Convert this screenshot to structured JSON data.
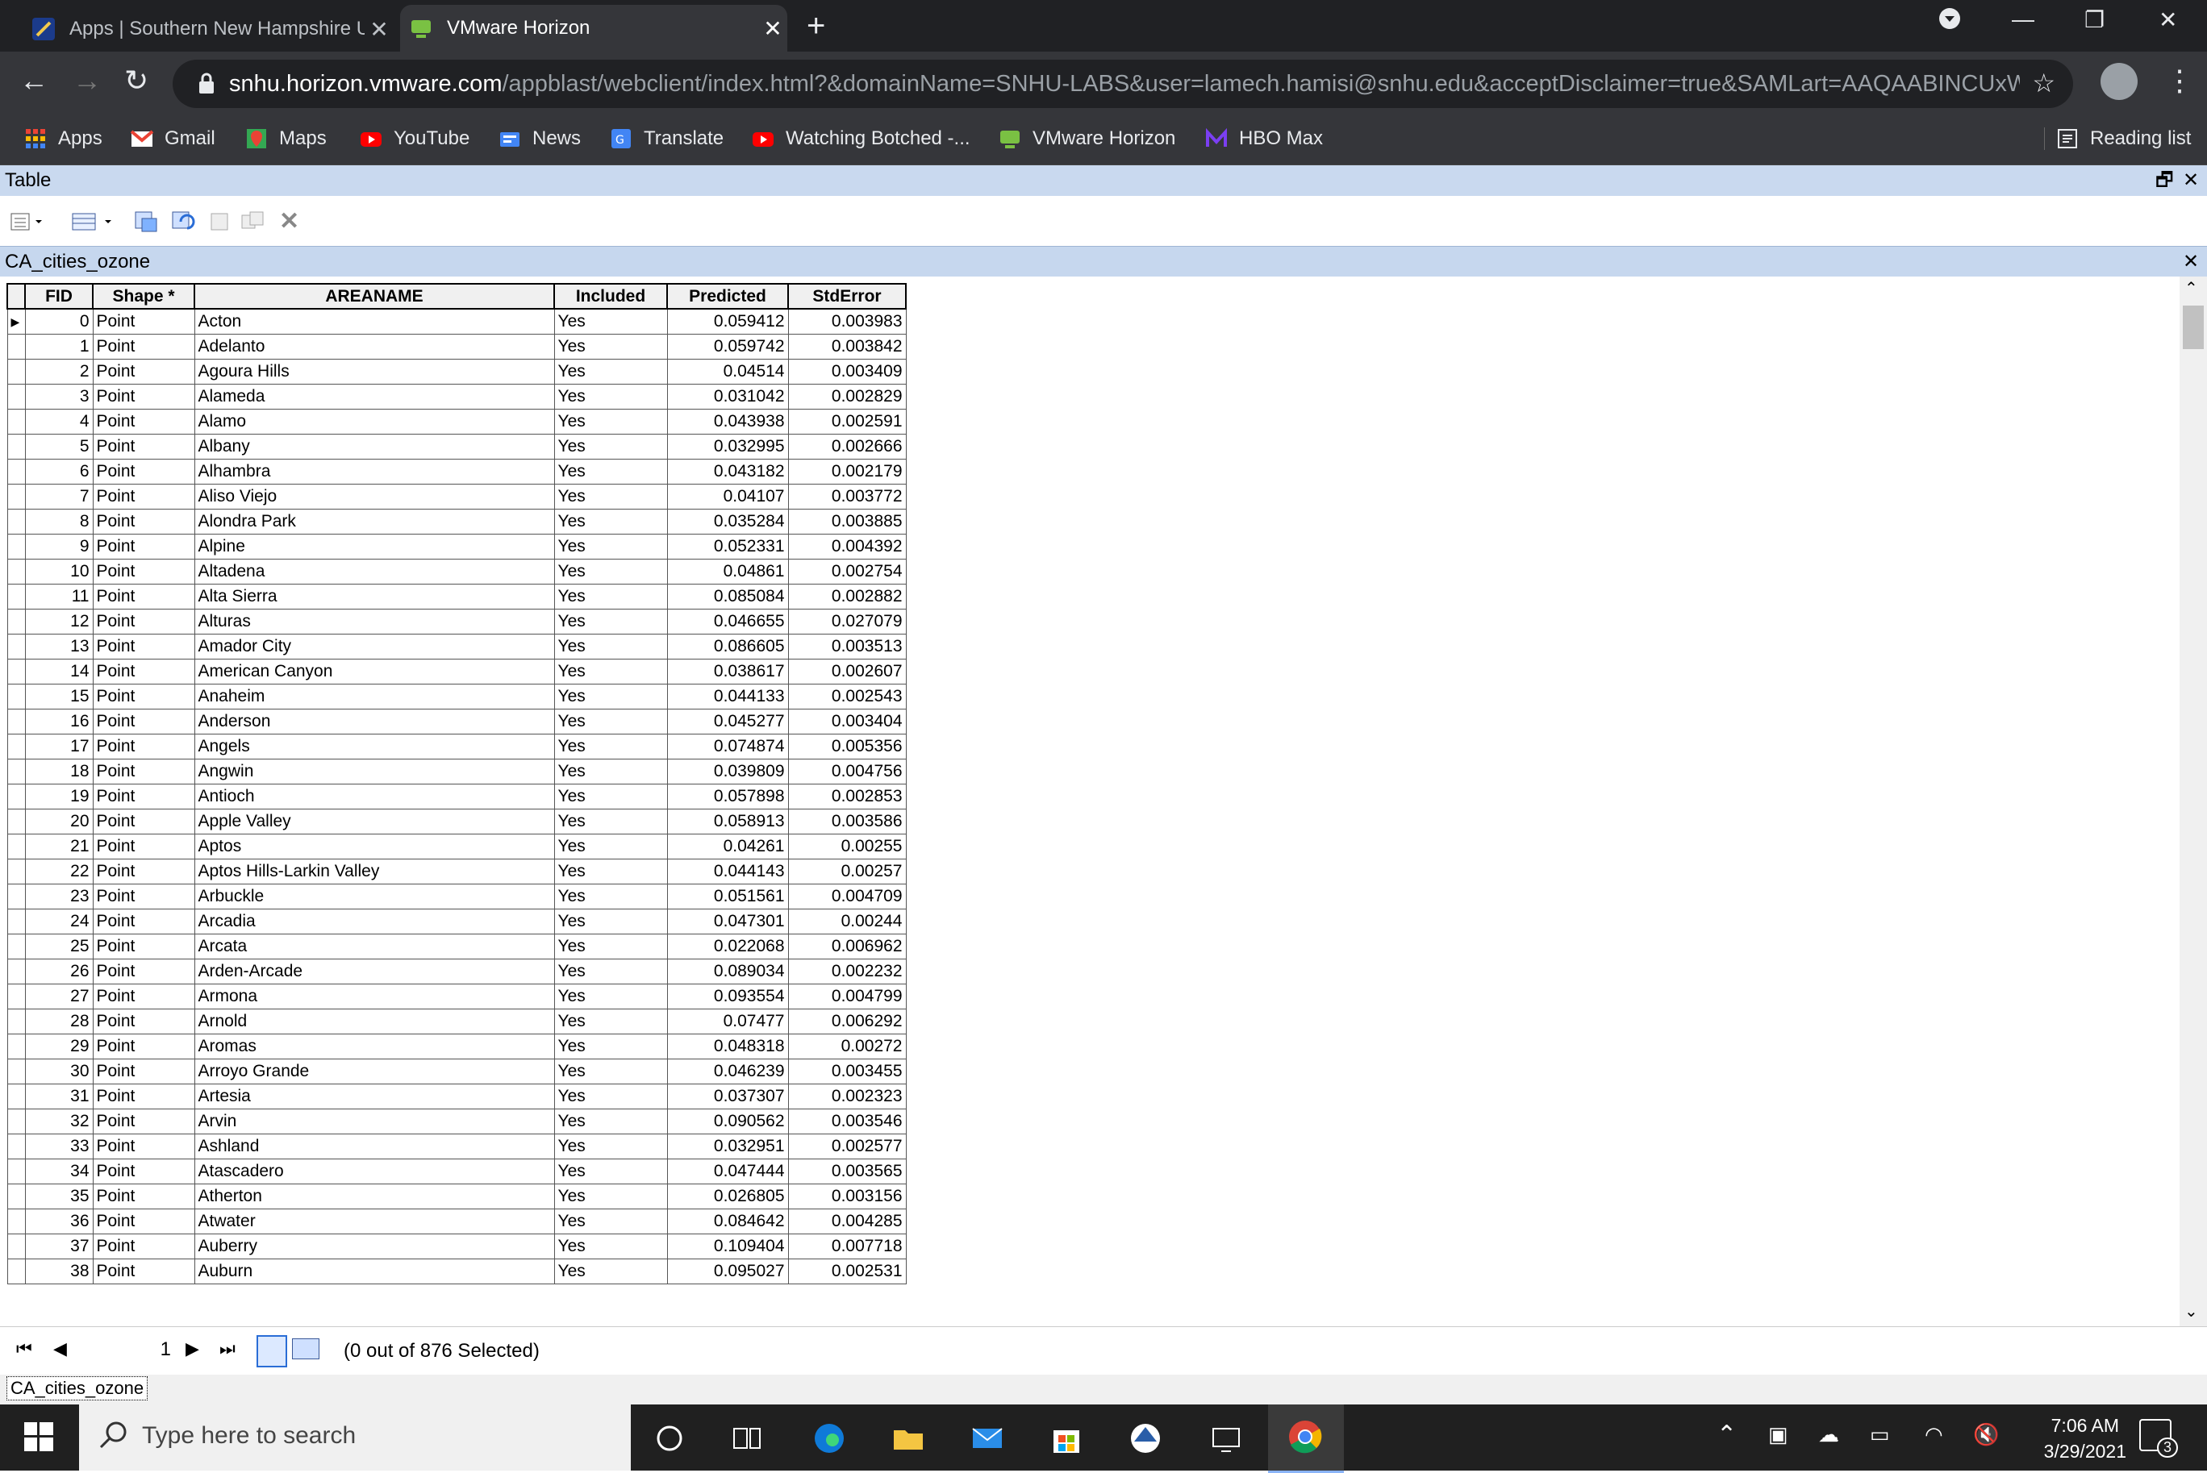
{
  "browser": {
    "tabs": [
      {
        "title": "Apps | Southern New Hampshire University",
        "active": false
      },
      {
        "title": "VMware Horizon",
        "active": true
      }
    ],
    "url_host": "snhu.horizon.vmware.com",
    "url_path": "/appblast/webclient/index.html?&domainName=SNHU-LABS&user=lamech.hamisi@snhu.edu&acceptDisclaimer=true&SAMLart=AAQAABINCUxWrog...",
    "bookmarks": [
      "Apps",
      "Gmail",
      "Maps",
      "YouTube",
      "News",
      "Translate",
      "Watching Botched -...",
      "VMware Horizon",
      "HBO Max"
    ],
    "reading_list": "Reading list"
  },
  "table_window": {
    "title": "Table",
    "layer_name": "CA_cities_ozone",
    "columns": [
      "FID",
      "Shape *",
      "AREANAME",
      "Included",
      "Predicted",
      "StdError"
    ],
    "rows": [
      [
        "0",
        "Point",
        "Acton",
        "Yes",
        "0.059412",
        "0.003983"
      ],
      [
        "1",
        "Point",
        "Adelanto",
        "Yes",
        "0.059742",
        "0.003842"
      ],
      [
        "2",
        "Point",
        "Agoura Hills",
        "Yes",
        "0.04514",
        "0.003409"
      ],
      [
        "3",
        "Point",
        "Alameda",
        "Yes",
        "0.031042",
        "0.002829"
      ],
      [
        "4",
        "Point",
        "Alamo",
        "Yes",
        "0.043938",
        "0.002591"
      ],
      [
        "5",
        "Point",
        "Albany",
        "Yes",
        "0.032995",
        "0.002666"
      ],
      [
        "6",
        "Point",
        "Alhambra",
        "Yes",
        "0.043182",
        "0.002179"
      ],
      [
        "7",
        "Point",
        "Aliso Viejo",
        "Yes",
        "0.04107",
        "0.003772"
      ],
      [
        "8",
        "Point",
        "Alondra Park",
        "Yes",
        "0.035284",
        "0.003885"
      ],
      [
        "9",
        "Point",
        "Alpine",
        "Yes",
        "0.052331",
        "0.004392"
      ],
      [
        "10",
        "Point",
        "Altadena",
        "Yes",
        "0.04861",
        "0.002754"
      ],
      [
        "11",
        "Point",
        "Alta Sierra",
        "Yes",
        "0.085084",
        "0.002882"
      ],
      [
        "12",
        "Point",
        "Alturas",
        "Yes",
        "0.046655",
        "0.027079"
      ],
      [
        "13",
        "Point",
        "Amador City",
        "Yes",
        "0.086605",
        "0.003513"
      ],
      [
        "14",
        "Point",
        "American Canyon",
        "Yes",
        "0.038617",
        "0.002607"
      ],
      [
        "15",
        "Point",
        "Anaheim",
        "Yes",
        "0.044133",
        "0.002543"
      ],
      [
        "16",
        "Point",
        "Anderson",
        "Yes",
        "0.045277",
        "0.003404"
      ],
      [
        "17",
        "Point",
        "Angels",
        "Yes",
        "0.074874",
        "0.005356"
      ],
      [
        "18",
        "Point",
        "Angwin",
        "Yes",
        "0.039809",
        "0.004756"
      ],
      [
        "19",
        "Point",
        "Antioch",
        "Yes",
        "0.057898",
        "0.002853"
      ],
      [
        "20",
        "Point",
        "Apple Valley",
        "Yes",
        "0.058913",
        "0.003586"
      ],
      [
        "21",
        "Point",
        "Aptos",
        "Yes",
        "0.04261",
        "0.00255"
      ],
      [
        "22",
        "Point",
        "Aptos Hills-Larkin Valley",
        "Yes",
        "0.044143",
        "0.00257"
      ],
      [
        "23",
        "Point",
        "Arbuckle",
        "Yes",
        "0.051561",
        "0.004709"
      ],
      [
        "24",
        "Point",
        "Arcadia",
        "Yes",
        "0.047301",
        "0.00244"
      ],
      [
        "25",
        "Point",
        "Arcata",
        "Yes",
        "0.022068",
        "0.006962"
      ],
      [
        "26",
        "Point",
        "Arden-Arcade",
        "Yes",
        "0.089034",
        "0.002232"
      ],
      [
        "27",
        "Point",
        "Armona",
        "Yes",
        "0.093554",
        "0.004799"
      ],
      [
        "28",
        "Point",
        "Arnold",
        "Yes",
        "0.07477",
        "0.006292"
      ],
      [
        "29",
        "Point",
        "Aromas",
        "Yes",
        "0.048318",
        "0.00272"
      ],
      [
        "30",
        "Point",
        "Arroyo Grande",
        "Yes",
        "0.046239",
        "0.003455"
      ],
      [
        "31",
        "Point",
        "Artesia",
        "Yes",
        "0.037307",
        "0.002323"
      ],
      [
        "32",
        "Point",
        "Arvin",
        "Yes",
        "0.090562",
        "0.003546"
      ],
      [
        "33",
        "Point",
        "Ashland",
        "Yes",
        "0.032951",
        "0.002577"
      ],
      [
        "34",
        "Point",
        "Atascadero",
        "Yes",
        "0.047444",
        "0.003565"
      ],
      [
        "35",
        "Point",
        "Atherton",
        "Yes",
        "0.026805",
        "0.003156"
      ],
      [
        "36",
        "Point",
        "Atwater",
        "Yes",
        "0.084642",
        "0.004285"
      ],
      [
        "37",
        "Point",
        "Auberry",
        "Yes",
        "0.109404",
        "0.007718"
      ],
      [
        "38",
        "Point",
        "Auburn",
        "Yes",
        "0.095027",
        "0.002531"
      ]
    ],
    "record_number": "1",
    "selection_status": "(0 out of 876 Selected)",
    "layer_tab": "CA_cities_ozone"
  },
  "taskbar": {
    "search_placeholder": "Type here to search",
    "time": "7:06 AM",
    "date": "3/29/2021",
    "notification_count": "3"
  },
  "colors": {
    "chrome_dark": "#202124",
    "chrome_mid": "#35363a",
    "arc_title": "#c9d9ef",
    "taskbar": "#202020"
  }
}
